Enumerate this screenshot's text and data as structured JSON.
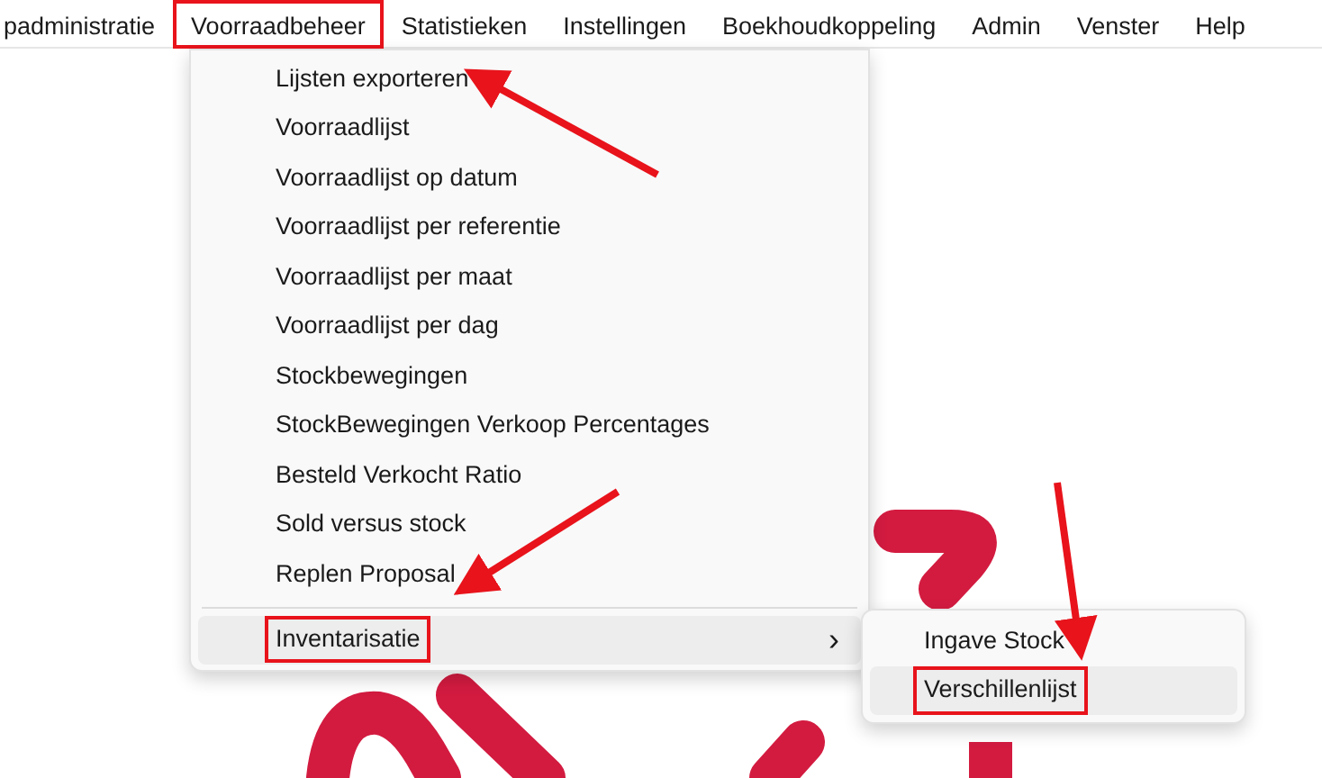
{
  "menu_bar": [
    {
      "label": "padministratie",
      "highlighted": false
    },
    {
      "label": "Voorraadbeheer",
      "highlighted": true
    },
    {
      "label": "Statistieken",
      "highlighted": false
    },
    {
      "label": "Instellingen",
      "highlighted": false
    },
    {
      "label": "Boekhoudkoppeling",
      "highlighted": false
    },
    {
      "label": "Admin",
      "highlighted": false
    },
    {
      "label": "Venster",
      "highlighted": false
    },
    {
      "label": "Help",
      "highlighted": false
    }
  ],
  "dropdown": [
    {
      "kind": "item",
      "label": "Lijsten exporteren",
      "selected": false,
      "highlighted": false
    },
    {
      "kind": "item",
      "label": "Voorraadlijst",
      "selected": false,
      "highlighted": false
    },
    {
      "kind": "item",
      "label": "Voorraadlijst op datum",
      "selected": false,
      "highlighted": false
    },
    {
      "kind": "item",
      "label": "Voorraadlijst per referentie",
      "selected": false,
      "highlighted": false
    },
    {
      "kind": "item",
      "label": "Voorraadlijst per maat",
      "selected": false,
      "highlighted": false
    },
    {
      "kind": "item",
      "label": "Voorraadlijst per dag",
      "selected": false,
      "highlighted": false
    },
    {
      "kind": "item",
      "label": "Stockbewegingen",
      "selected": false,
      "highlighted": false
    },
    {
      "kind": "item",
      "label": "StockBewegingen Verkoop Percentages",
      "selected": false,
      "highlighted": false
    },
    {
      "kind": "item",
      "label": "Besteld Verkocht Ratio",
      "selected": false,
      "highlighted": false
    },
    {
      "kind": "item",
      "label": "Sold versus stock",
      "selected": false,
      "highlighted": false
    },
    {
      "kind": "item",
      "label": "Replen Proposal",
      "selected": false,
      "highlighted": false
    },
    {
      "kind": "separator"
    },
    {
      "kind": "submenu",
      "label": "Inventarisatie",
      "arrow": "›",
      "selected": true,
      "highlighted": true
    }
  ],
  "submenu": [
    {
      "label": "Ingave Stock",
      "selected": false,
      "highlighted": false
    },
    {
      "label": "Verschillenlijst",
      "selected": true,
      "highlighted": true
    }
  ]
}
